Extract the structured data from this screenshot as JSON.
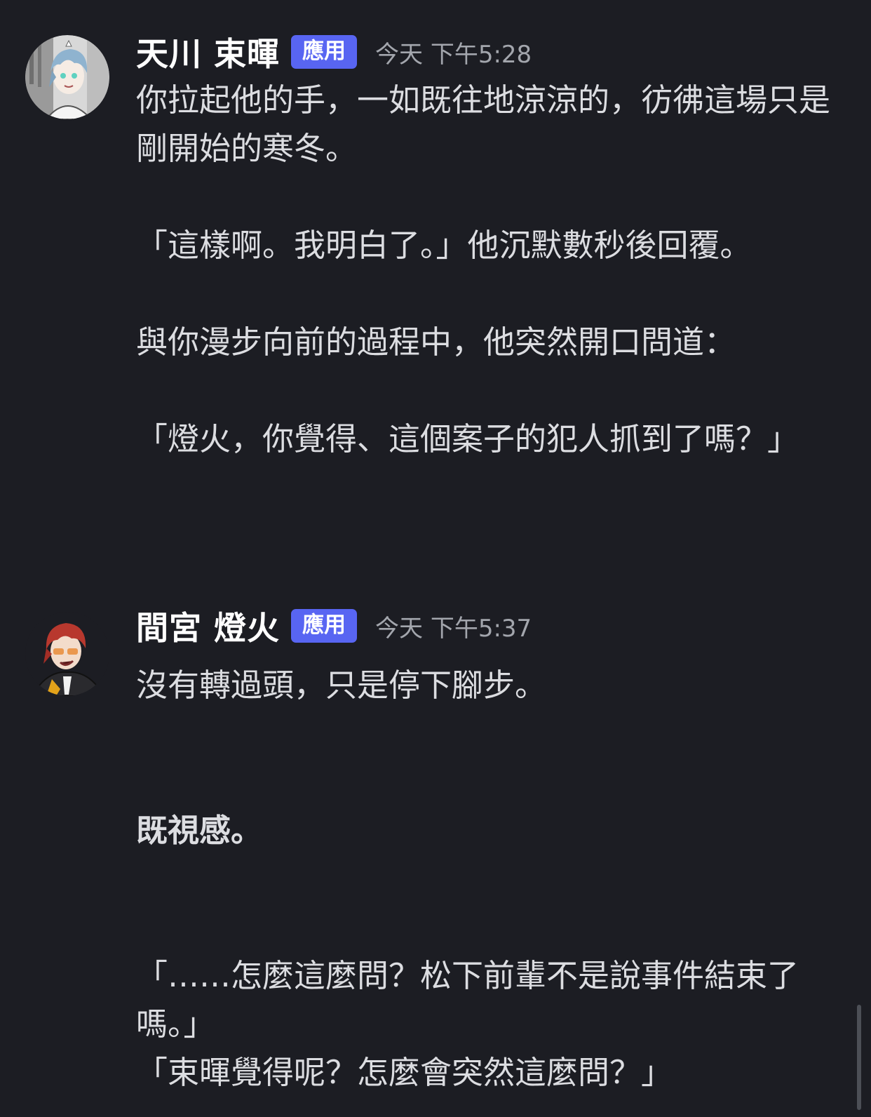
{
  "messages": [
    {
      "username": "天川 束暉",
      "badge": "應用",
      "timestamp": "今天 下午5:28",
      "avatar_icon": "avatar-blue-hair-character",
      "paragraphs": [
        "你拉起他的手，一如既往地涼涼的，彷彿這場只是剛開始的寒冬。",
        "「這樣啊。我明白了。」他沉默數秒後回覆。",
        "與你漫步向前的過程中，他突然開口問道：",
        "「燈火，你覺得、這個案子的犯人抓到了嗎？」"
      ]
    },
    {
      "username": "間宮 燈火",
      "badge": "應用",
      "timestamp": "今天 下午5:37",
      "avatar_icon": "avatar-red-hair-character",
      "line1": "沒有轉過頭，只是停下腳步。",
      "bold_line": "既視感。",
      "line3": "「……怎麼這麼問？松下前輩不是說事件結束了嗎。」",
      "line4": "「束暉覺得呢？怎麼會突然這麼問？」"
    }
  ],
  "colors": {
    "background": "#1c1d23",
    "badge": "#5865f2",
    "text": "#dcdde1",
    "timestamp": "#a3a6ad"
  }
}
